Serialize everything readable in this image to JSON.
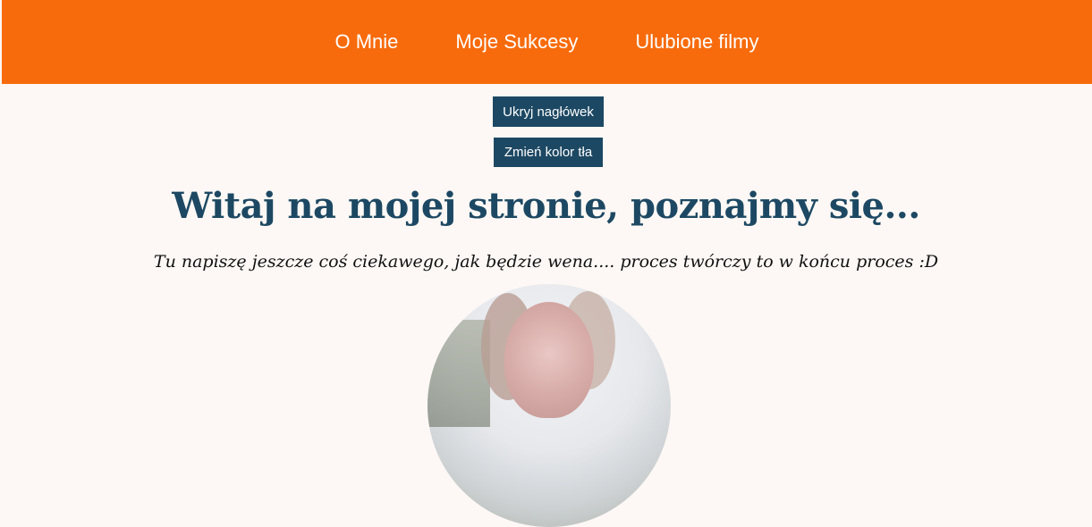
{
  "nav": {
    "items": [
      {
        "label": "O Mnie"
      },
      {
        "label": "Moje Sukcesy"
      },
      {
        "label": "Ulubione filmy"
      }
    ]
  },
  "buttons": {
    "hide_header": "Ukryj nagłówek",
    "change_bg": "Zmień kolor tła"
  },
  "main": {
    "title": "Witaj na mojej stronie, poznajmy się...",
    "subtitle": "Tu napiszę jeszcze coś ciekawego, jak będzie wena.... proces twórczy to w końcu proces :D"
  },
  "colors": {
    "header_bg": "#f76b0c",
    "page_bg": "#fdf8f5",
    "accent": "#1d4863"
  },
  "icons": {
    "avatar": "profile-photo"
  }
}
